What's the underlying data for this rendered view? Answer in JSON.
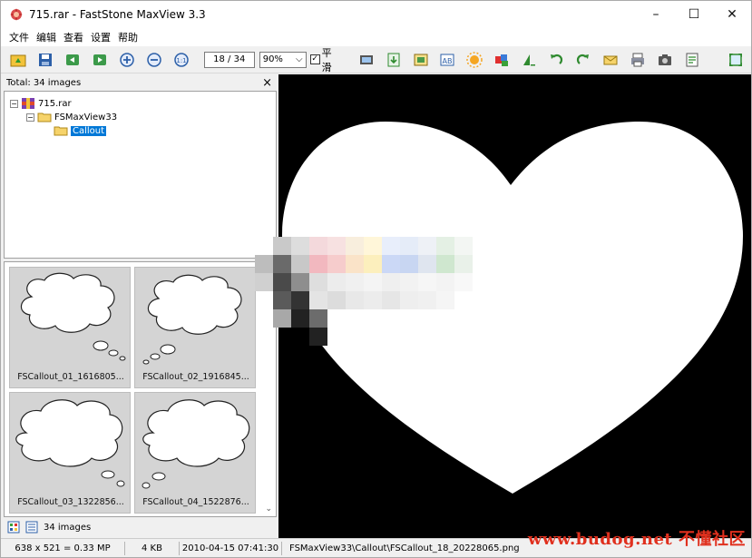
{
  "window": {
    "title": "715.rar - FastStone MaxView 3.3",
    "minimize": "–",
    "maximize": "☐",
    "close": "✕"
  },
  "menu": [
    "文件",
    "编辑",
    "查看",
    "设置",
    "帮助"
  ],
  "toolbar": {
    "page_indicator": "18 / 34",
    "zoom_value": "90%",
    "smooth_label": "平滑",
    "smooth_checked": true,
    "icons": [
      "open-folder-icon",
      "save-icon",
      "previous-image-icon",
      "next-image-icon",
      "zoom-in-icon",
      "zoom-out-icon",
      "actual-size-icon"
    ],
    "right_icons": [
      "slideshow-icon",
      "export-icon",
      "resize-icon",
      "rename-icon",
      "adjust-colors-icon",
      "colors-icon",
      "sharpen-icon",
      "rotate-left-icon",
      "rotate-right-icon",
      "email-icon",
      "print-icon",
      "camera-icon",
      "properties-icon",
      "fullscreen-icon"
    ]
  },
  "left_panel": {
    "header": "Total: 34 images",
    "close": "×",
    "tree": [
      {
        "label": "715.rar",
        "toggle": "⊟"
      },
      {
        "label": "FSMaxView33",
        "toggle": "⊟"
      },
      {
        "label": "Callout",
        "selected": true
      }
    ],
    "thumbnails": [
      {
        "label": "FSCallout_01_1616805..."
      },
      {
        "label": "FSCallout_02_1916845..."
      },
      {
        "label": "FSCallout_03_1322856..."
      },
      {
        "label": "FSCallout_04_1522876..."
      }
    ],
    "footer": "34 images"
  },
  "status": {
    "dimensions": "638 x 521 = 0.33 MP",
    "size": "4 KB",
    "date": "2010-04-15 07:41:30",
    "path": "FSMaxView33\\Callout\\FSCallout_18_20228065.png"
  },
  "watermark": "www.budog.net 不懂社区",
  "colors": {
    "accent": "#0078d7",
    "viewer_background": "#000000",
    "watermark": "#e0301e"
  }
}
